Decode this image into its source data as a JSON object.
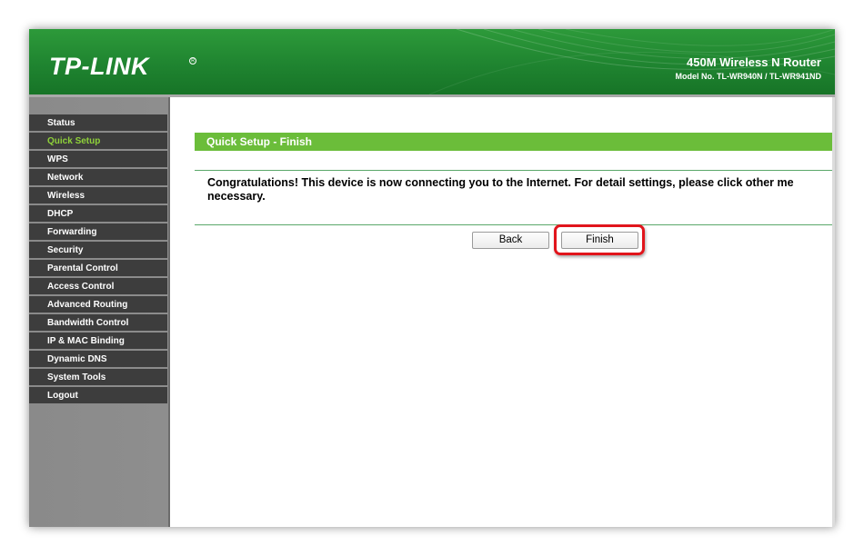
{
  "header": {
    "logo_text": "TP-LINK",
    "product_title": "450M Wireless N Router",
    "model_number": "Model No. TL-WR940N / TL-WR941ND"
  },
  "sidebar": {
    "items": [
      {
        "label": "Status",
        "active": false
      },
      {
        "label": "Quick Setup",
        "active": true
      },
      {
        "label": "WPS",
        "active": false
      },
      {
        "label": "Network",
        "active": false
      },
      {
        "label": "Wireless",
        "active": false
      },
      {
        "label": "DHCP",
        "active": false
      },
      {
        "label": "Forwarding",
        "active": false
      },
      {
        "label": "Security",
        "active": false
      },
      {
        "label": "Parental Control",
        "active": false
      },
      {
        "label": "Access Control",
        "active": false
      },
      {
        "label": "Advanced Routing",
        "active": false
      },
      {
        "label": "Bandwidth Control",
        "active": false
      },
      {
        "label": "IP & MAC Binding",
        "active": false
      },
      {
        "label": "Dynamic DNS",
        "active": false
      },
      {
        "label": "System Tools",
        "active": false
      },
      {
        "label": "Logout",
        "active": false
      }
    ]
  },
  "main": {
    "section_title": "Quick Setup - Finish",
    "message_line1": "Congratulations! This device is now connecting you to the Internet. For detail settings, please click other me",
    "message_line2": "necessary.",
    "back_label": "Back",
    "finish_label": "Finish"
  },
  "colors": {
    "brand_green": "#1f8430",
    "section_green": "#6bbd3a",
    "active_menu": "#8fd23a",
    "menu_bg": "#3d3d3d",
    "highlight_red": "#e1151c"
  }
}
